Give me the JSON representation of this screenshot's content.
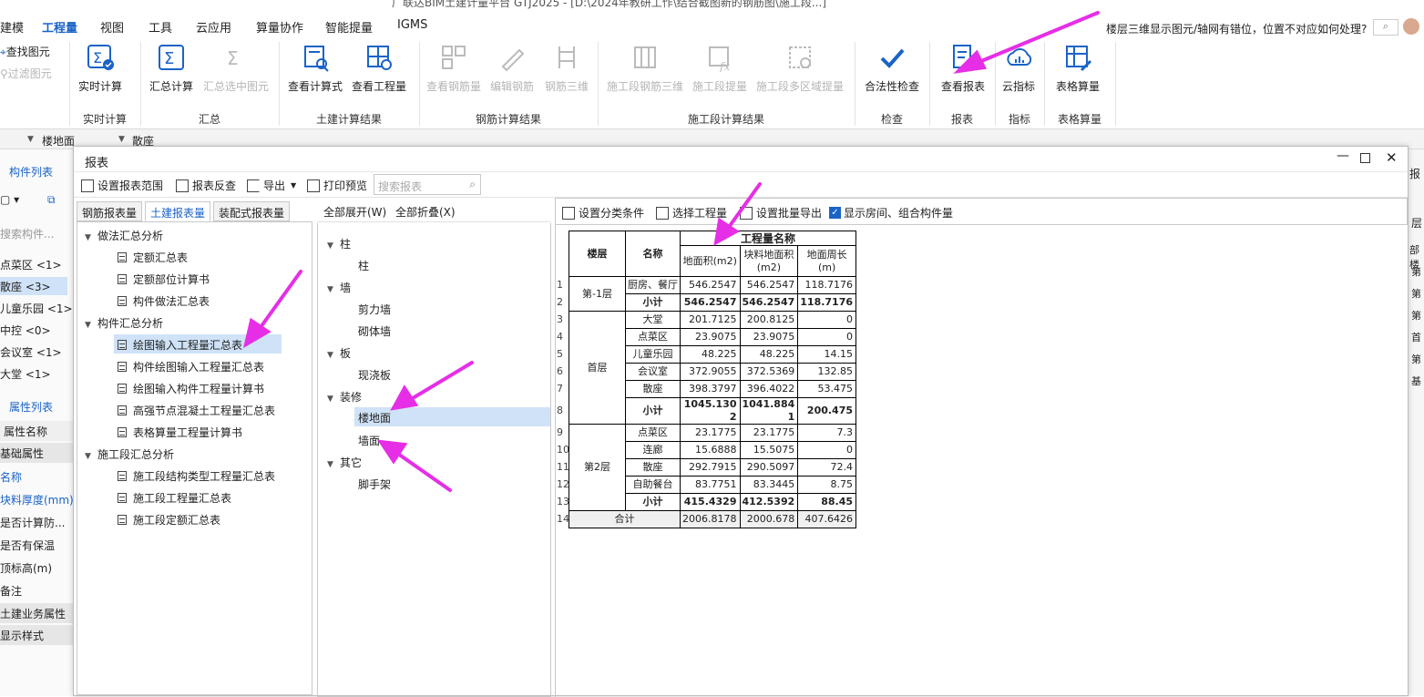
{
  "app_title": "广联达BIM土建计量平台 GTJ2025 - [D:\\2024年教研工作\\结合截图新的钢筋图\\施工段...]",
  "menu": [
    "建模",
    "工程量",
    "视图",
    "工具",
    "云应用",
    "算量协作",
    "智能提量",
    "IGMS"
  ],
  "menu_active": "工程量",
  "help_text": "楼层三维显示图元/轴网有错位，位置不对应如何处理?",
  "left_quick": [
    "查找图元",
    "过滤图元"
  ],
  "ribbon": {
    "buttons": [
      {
        "label": "实时计算",
        "disabled": false
      },
      {
        "label": "汇总计算",
        "disabled": false
      },
      {
        "label": "汇总选中图元",
        "disabled": true
      },
      {
        "label": "查看计算式",
        "disabled": false
      },
      {
        "label": "查看工程量",
        "disabled": false
      },
      {
        "label": "查看钢筋量",
        "disabled": true
      },
      {
        "label": "编辑钢筋",
        "disabled": true
      },
      {
        "label": "钢筋三维",
        "disabled": true
      },
      {
        "label": "施工段钢筋三维",
        "disabled": true
      },
      {
        "label": "施工段提量",
        "disabled": true
      },
      {
        "label": "施工段多区域提量",
        "disabled": true
      },
      {
        "label": "合法性检查",
        "disabled": false
      },
      {
        "label": "查看报表",
        "disabled": false
      },
      {
        "label": "云指标",
        "disabled": false
      },
      {
        "label": "表格算量",
        "disabled": false
      }
    ],
    "groups": [
      "实时计算",
      "汇总",
      "土建计算结果",
      "钢筋计算结果",
      "施工段计算结果",
      "检查",
      "报表",
      "指标",
      "表格算量"
    ]
  },
  "strip": {
    "floor": "楼地面",
    "type": "散座"
  },
  "left_panel": {
    "tab1": "构件列表",
    "search": "搜索构件...",
    "items": [
      "点菜区 <1>",
      "散座 <3>",
      "儿童乐园 <1>",
      "中控 <0>",
      "会议室 <1>",
      "大堂 <1>"
    ],
    "tab2": "属性列表",
    "prop_header": "属性名称",
    "props": [
      "基础属性",
      "名称",
      "块料厚度(mm)",
      "是否计算防...",
      "是否有保温",
      "顶标高(m)",
      "备注",
      "土建业务属性",
      "显示样式"
    ]
  },
  "right_edge": [
    "报",
    "层",
    "部楼",
    "第",
    "第",
    "第",
    "首",
    "第",
    "基"
  ],
  "dialog": {
    "title": "报表",
    "toolbar": [
      "设置报表范围",
      "报表反查",
      "导出",
      "打印预览"
    ],
    "search_placeholder": "搜索报表",
    "tabs": [
      "钢筋报表量",
      "土建报表量",
      "装配式报表量"
    ],
    "active_tab": "土建报表量",
    "tree": [
      {
        "label": "做法汇总分析",
        "children": [
          "定额汇总表",
          "定额部位计算书",
          "构件做法汇总表"
        ]
      },
      {
        "label": "构件汇总分析",
        "children": [
          "绘图输入工程量汇总表",
          "构件绘图输入工程量汇总表",
          "绘图输入构件工程量计算书",
          "高强节点混凝土工程量汇总表",
          "表格算量工程量计算书"
        ]
      },
      {
        "label": "施工段汇总分析",
        "children": [
          "施工段结构类型工程量汇总表",
          "施工段工程量汇总表",
          "施工段定额汇总表"
        ]
      }
    ],
    "selected_report": "绘图输入工程量汇总表",
    "expand_all": "全部展开(W)",
    "collapse_all": "全部折叠(X)",
    "categories": [
      {
        "label": "柱",
        "children": [
          "柱"
        ]
      },
      {
        "label": "墙",
        "children": [
          "剪力墙",
          "砌体墙"
        ]
      },
      {
        "label": "板",
        "children": [
          "现浇板"
        ]
      },
      {
        "label": "装修",
        "children": [
          "楼地面",
          "墙面"
        ]
      },
      {
        "label": "其它",
        "children": [
          "脚手架"
        ]
      }
    ],
    "selected_category": "楼地面",
    "report_toolbar": [
      "设置分类条件",
      "选择工程量",
      "设置批量导出",
      "显示房间、组合构件量"
    ],
    "table": {
      "h_floor": "楼层",
      "h_name": "名称",
      "h_group": "工程量名称",
      "h_cols": [
        "地面积(m2)",
        "块料地面积(m2)",
        "地面周长(m)"
      ],
      "rows": [
        {
          "n": "1",
          "floor": "第-1层",
          "name": "厨房、餐厅",
          "v": [
            "546.2547",
            "546.2547",
            "118.7176"
          ],
          "bold": false
        },
        {
          "n": "2",
          "floor": "",
          "name": "小计",
          "v": [
            "546.2547",
            "546.2547",
            "118.7176"
          ],
          "bold": true
        },
        {
          "n": "3",
          "floor": "首层",
          "name": "大堂",
          "v": [
            "201.7125",
            "200.8125",
            "0"
          ],
          "bold": false
        },
        {
          "n": "4",
          "floor": "",
          "name": "点菜区",
          "v": [
            "23.9075",
            "23.9075",
            "0"
          ],
          "bold": false
        },
        {
          "n": "5",
          "floor": "",
          "name": "儿童乐园",
          "v": [
            "48.225",
            "48.225",
            "14.15"
          ],
          "bold": false
        },
        {
          "n": "6",
          "floor": "",
          "name": "会议室",
          "v": [
            "372.9055",
            "372.5369",
            "132.85"
          ],
          "bold": false
        },
        {
          "n": "7",
          "floor": "",
          "name": "散座",
          "v": [
            "398.3797",
            "396.4022",
            "53.475"
          ],
          "bold": false
        },
        {
          "n": "8",
          "floor": "",
          "name": "小计",
          "v": [
            "1045.1302",
            "1041.8841",
            "200.475"
          ],
          "bold": true
        },
        {
          "n": "9",
          "floor": "第2层",
          "name": "点菜区",
          "v": [
            "23.1775",
            "23.1775",
            "7.3"
          ],
          "bold": false
        },
        {
          "n": "10",
          "floor": "",
          "name": "连廊",
          "v": [
            "15.6888",
            "15.5075",
            "0"
          ],
          "bold": false
        },
        {
          "n": "11",
          "floor": "",
          "name": "散座",
          "v": [
            "292.7915",
            "290.5097",
            "72.4"
          ],
          "bold": false
        },
        {
          "n": "12",
          "floor": "",
          "name": "自助餐台",
          "v": [
            "83.7751",
            "83.3445",
            "8.75"
          ],
          "bold": false
        },
        {
          "n": "13",
          "floor": "",
          "name": "小计",
          "v": [
            "415.4329",
            "412.5392",
            "88.45"
          ],
          "bold": true
        }
      ],
      "total_label": "合计",
      "total_n": "14",
      "total": [
        "2006.8178",
        "2000.678",
        "407.6426"
      ]
    }
  },
  "colors": {
    "accent": "#1a63c7",
    "annotation_arrow": "#e62ee6",
    "selection": "#cfe2f7"
  }
}
